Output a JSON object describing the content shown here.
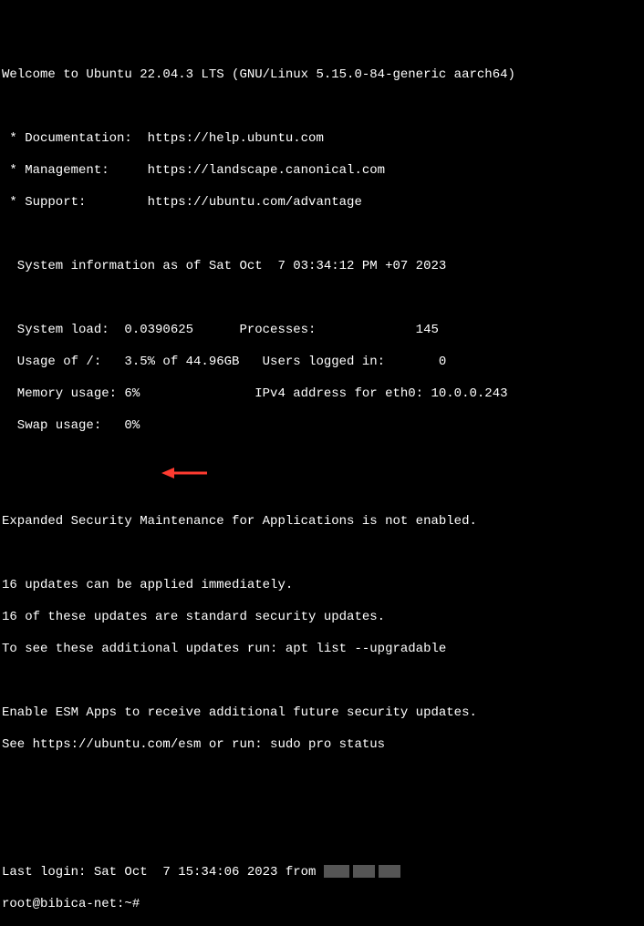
{
  "welcome": "Welcome to Ubuntu 22.04.3 LTS (GNU/Linux 5.15.0-84-generic aarch64)",
  "links": {
    "doc": " * Documentation:  https://help.ubuntu.com",
    "mgmt": " * Management:     https://landscape.canonical.com",
    "support": " * Support:        https://ubuntu.com/advantage"
  },
  "sysinfo_header": "  System information as of Sat Oct  7 03:34:12 PM +07 2023",
  "stats": {
    "l1": "  System load:  0.0390625      Processes:             145",
    "l2": "  Usage of /:   3.5% of 44.96GB   Users logged in:       0",
    "l3": "  Memory usage: 6%               IPv4 address for eth0: 10.0.0.243",
    "l4": "  Swap usage:   0%"
  },
  "esm_line": "Expanded Security Maintenance for Applications is not enabled.",
  "updates": {
    "l1": "16 updates can be applied immediately.",
    "l2": "16 of these updates are standard security updates.",
    "l3": "To see these additional updates run: apt list --upgradable"
  },
  "esm2": {
    "l1": "Enable ESM Apps to receive additional future security updates.",
    "l2": "See https://ubuntu.com/esm or run: sudo pro status"
  },
  "last_login_prefix": "Last login: Sat Oct  7 15:34:06 2023 from ",
  "prompt": "root@bibica-net:~# "
}
